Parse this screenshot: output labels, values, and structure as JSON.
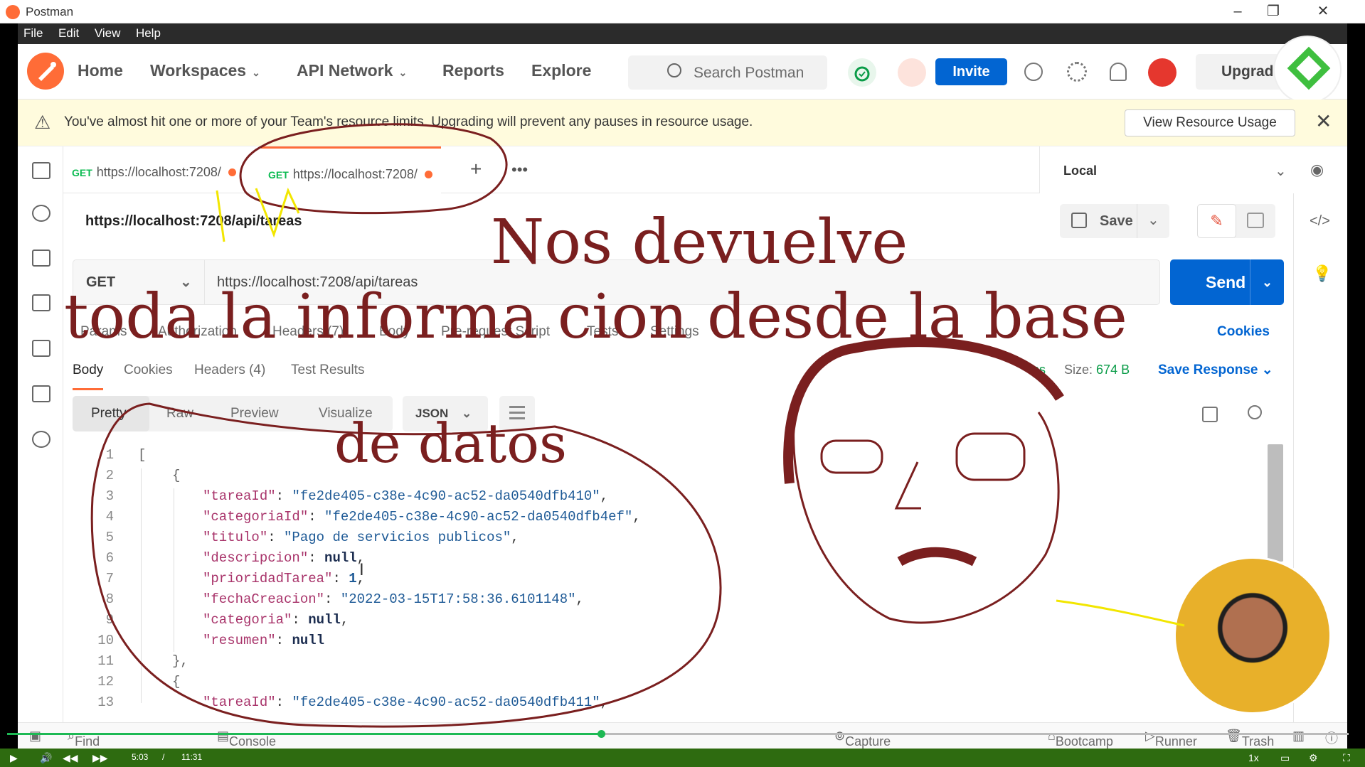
{
  "window": {
    "title": "Postman",
    "controls": [
      "minimize",
      "restore",
      "close"
    ]
  },
  "menu": [
    "File",
    "Edit",
    "View",
    "Help"
  ],
  "header": {
    "nav": [
      {
        "label": "Home",
        "dropdown": false
      },
      {
        "label": "Workspaces",
        "dropdown": true
      },
      {
        "label": "API Network",
        "dropdown": true
      },
      {
        "label": "Reports",
        "dropdown": false
      },
      {
        "label": "Explore",
        "dropdown": false
      }
    ],
    "search_placeholder": "Search Postman",
    "invite_label": "Invite",
    "upgrade_label": "Upgrade"
  },
  "banner": {
    "message": "You've almost hit one or more of your Team's resource limits. Upgrading will prevent any pauses in resource usage.",
    "button": "View Resource Usage"
  },
  "tabs": [
    {
      "method": "GET",
      "label": "https://localhost:7208/",
      "unsaved": true,
      "active": false
    },
    {
      "method": "GET",
      "label": "https://localhost:7208/",
      "unsaved": true,
      "active": true
    }
  ],
  "environment": "Local",
  "request": {
    "name": "https://localhost:7208/api/tareas",
    "method": "GET",
    "url": "https://localhost:7208/api/tareas",
    "save_label": "Save",
    "send_label": "Send",
    "tabs": [
      "Params",
      "Authorization",
      "Headers (7)",
      "Body",
      "Pre-request Script",
      "Tests",
      "Settings"
    ],
    "cookies_label": "Cookies"
  },
  "response": {
    "tabs": [
      "Body",
      "Cookies",
      "Headers (4)",
      "Test Results"
    ],
    "time": "ms",
    "size_label": "Size:",
    "size_value": "674 B",
    "save_response": "Save Response",
    "formats": [
      "Pretty",
      "Raw",
      "Preview",
      "Visualize"
    ],
    "language": "JSON",
    "code_lines": [
      {
        "n": "1"
      },
      {
        "n": "2"
      },
      {
        "n": "3"
      },
      {
        "n": "4"
      },
      {
        "n": "5"
      },
      {
        "n": "6"
      },
      {
        "n": "7"
      },
      {
        "n": "8"
      },
      {
        "n": "9"
      },
      {
        "n": "10"
      },
      {
        "n": "11"
      },
      {
        "n": "12"
      },
      {
        "n": "13"
      }
    ],
    "json": {
      "tareaId": "\"fe2de405-c38e-4c90-ac52-da0540dfb410\"",
      "categoriaId": "\"fe2de405-c38e-4c90-ac52-da0540dfb4ef\"",
      "titulo": "\"Pago de servicios publicos\"",
      "descripcion": "null",
      "prioridadTarea": "1",
      "fechaCreacion": "\"2022-03-15T17:58:36.6101148\"",
      "categoria": "null",
      "resumen": "null",
      "tareaId2": "\"fe2de405-c38e-4c90-ac52-da0540dfb411\""
    }
  },
  "statusbar": [
    "Find and Replace",
    "Console",
    "Capture requests and cookies",
    "Bootcamp",
    "Runner",
    "Trash"
  ],
  "video": {
    "current": "5:03",
    "separator": "/",
    "total": "11:31",
    "speed": "1x",
    "progress": 0.44
  },
  "annotations": {
    "line1": "Nos devuelve",
    "line2": "toda la informa cion desde la base",
    "line3": "de datos"
  },
  "colors": {
    "accent": "#ff6c37",
    "primary": "#0265d2",
    "ink": "#7a1f1f",
    "highlighter": "#f2e600"
  }
}
